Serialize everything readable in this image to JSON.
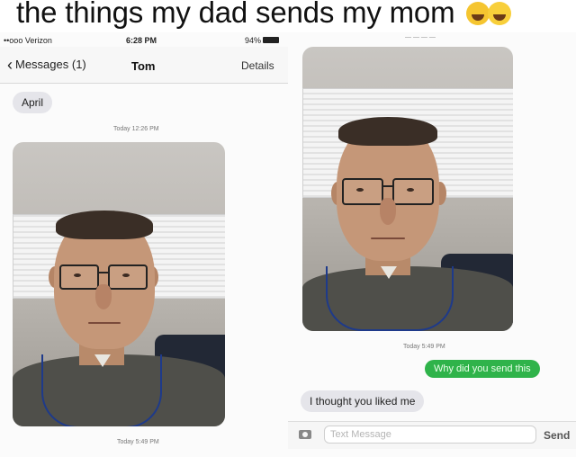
{
  "caption": "the things my dad sends my mom",
  "caption_emojis": [
    "crying-face-icon",
    "laughing-tears-icon"
  ],
  "left": {
    "status": {
      "carrier": "••ooo Verizon",
      "time": "6:28 PM",
      "battery": "94%"
    },
    "nav": {
      "back_label": "Messages (1)",
      "title": "Tom",
      "details_label": "Details"
    },
    "messages": [
      {
        "type": "incoming",
        "text": "April"
      },
      {
        "type": "timestamp",
        "text": "Today 12:26 PM"
      },
      {
        "type": "photo"
      },
      {
        "type": "timestamp",
        "text": "Today 5:49 PM"
      }
    ]
  },
  "right": {
    "messages": [
      {
        "type": "photo"
      },
      {
        "type": "timestamp",
        "text": "Today 5:49 PM"
      },
      {
        "type": "outgoing",
        "text": "Why did you send this"
      },
      {
        "type": "incoming",
        "text": "I thought you liked me"
      }
    ],
    "compose": {
      "placeholder": "Text Message",
      "send_label": "Send"
    }
  },
  "colors": {
    "outgoing_bubble": "#2fb34a",
    "incoming_bubble": "#e5e5ea"
  }
}
